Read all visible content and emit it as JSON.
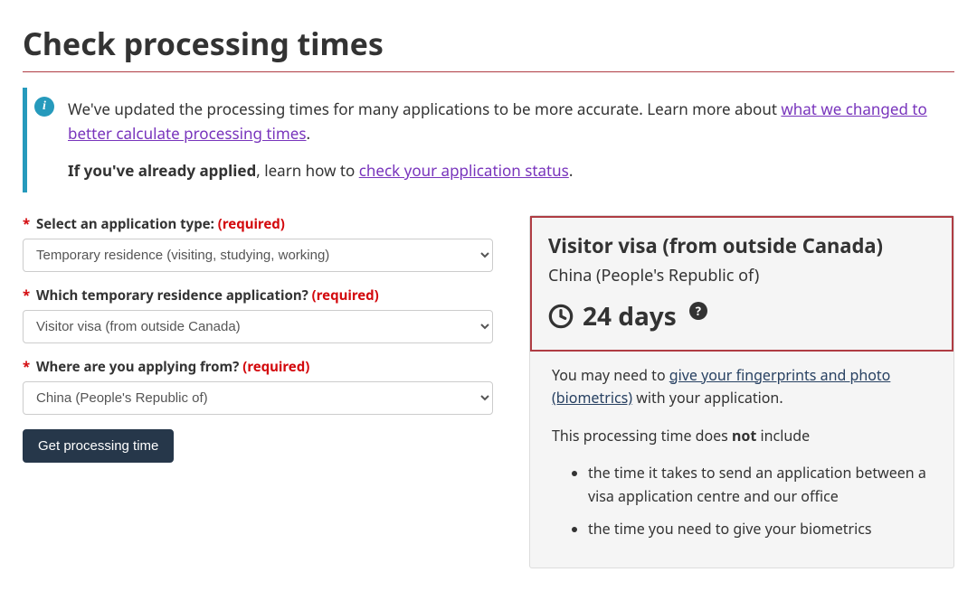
{
  "page_title": "Check processing times",
  "info": {
    "text1": "We've updated the processing times for many applications to be more accurate. Learn more about ",
    "link1": "what we changed to better calculate processing times",
    "text1_end": ".",
    "text2_strong": "If you've already applied",
    "text2_mid": ", learn how to ",
    "link2": "check your application status",
    "text2_end": "."
  },
  "form": {
    "q1": {
      "label": "Select an application type:",
      "required": "(required)",
      "value": "Temporary residence (visiting, studying, working)"
    },
    "q2": {
      "label": "Which temporary residence application?",
      "required": "(required)",
      "value": "Visitor visa (from outside Canada)"
    },
    "q3": {
      "label": "Where are you applying from?",
      "required": "(required)",
      "value": "China (People's Republic of)"
    },
    "button": "Get processing time"
  },
  "result": {
    "title": "Visitor visa (from outside Canada)",
    "country": "China (People's Republic of)",
    "time": "24 days",
    "body": {
      "p1_a": "You may need to ",
      "p1_link": "give your fingerprints and photo (biometrics)",
      "p1_b": " with your application.",
      "p2_a": "This processing time does ",
      "p2_strong": "not",
      "p2_b": " include",
      "li1": "the time it takes to send an application between a visa application centre and our office",
      "li2": "the time you need to give your biometrics"
    }
  }
}
